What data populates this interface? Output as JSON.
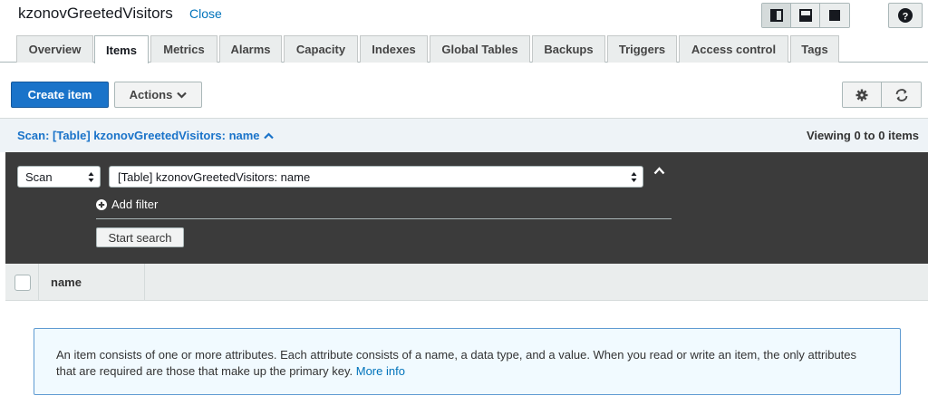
{
  "header": {
    "table_name": "kzonovGreetedVisitors",
    "close_label": "Close"
  },
  "tabs": [
    {
      "label": "Overview"
    },
    {
      "label": "Items",
      "active": true
    },
    {
      "label": "Metrics"
    },
    {
      "label": "Alarms"
    },
    {
      "label": "Capacity"
    },
    {
      "label": "Indexes"
    },
    {
      "label": "Global Tables"
    },
    {
      "label": "Backups"
    },
    {
      "label": "Triggers"
    },
    {
      "label": "Access control"
    },
    {
      "label": "Tags"
    }
  ],
  "toolbar": {
    "create_label": "Create item",
    "actions_label": "Actions"
  },
  "scan_bar": {
    "label": "Scan: [Table] kzonovGreetedVisitors: name",
    "viewing": "Viewing 0 to 0 items"
  },
  "search": {
    "mode": "Scan",
    "target": "[Table] kzonovGreetedVisitors: name",
    "add_filter_label": "Add filter",
    "start_label": "Start search"
  },
  "results": {
    "columns": [
      "name"
    ]
  },
  "info": {
    "text": "An item consists of one or more attributes. Each attribute consists of a name, a data type, and a value. When you read or write an item, the only attributes that are required are those that make up the primary key.",
    "more_info_label": "More info"
  },
  "colors": {
    "primary": "#1a73c9",
    "link": "#0073bb",
    "panel_dark": "#3b3b3b"
  }
}
